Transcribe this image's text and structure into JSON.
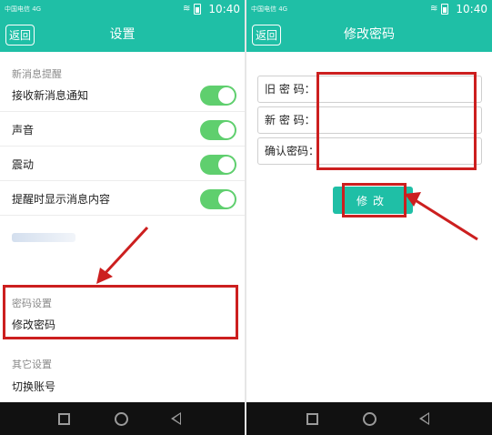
{
  "status_bar": {
    "carrier": "中国电信 4G",
    "time": "10:40"
  },
  "left_screen": {
    "back_label": "返回",
    "title": "设置",
    "sections": [
      {
        "header": "新消息提醒",
        "items": [
          {
            "label": "接收新消息通知",
            "toggle": true
          },
          {
            "label": "声音",
            "toggle": true
          },
          {
            "label": "震动",
            "toggle": true
          },
          {
            "label": "提醒时显示消息内容",
            "toggle": true
          }
        ]
      },
      {
        "header": "密码设置",
        "items": [
          {
            "label": "修改密码"
          }
        ]
      },
      {
        "header": "其它设置",
        "items": [
          {
            "label": "切换账号"
          }
        ]
      }
    ]
  },
  "right_screen": {
    "back_label": "返回",
    "title": "修改密码",
    "fields": [
      {
        "label": "旧 密 码：",
        "value": ""
      },
      {
        "label": "新 密 码：",
        "value": ""
      },
      {
        "label": "确认密码：",
        "value": ""
      }
    ],
    "submit_label": "修改"
  },
  "colors": {
    "accent": "#1fbfa6",
    "toggle_on": "#5fcf6e",
    "highlight": "#cc1f1f"
  },
  "nav_icons": [
    "square-icon",
    "circle-icon",
    "back-triangle-icon"
  ]
}
